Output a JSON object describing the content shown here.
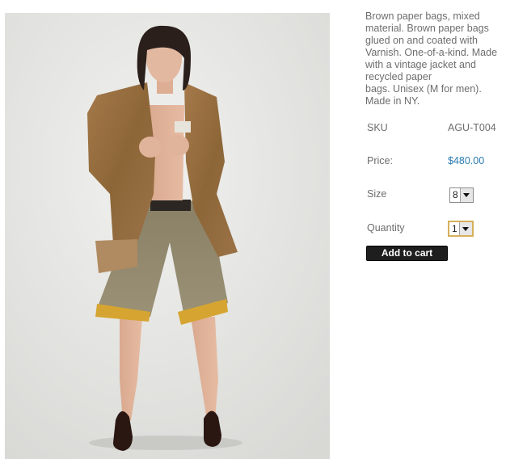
{
  "product": {
    "image_alt": "Model wearing brown paper bag jacket and khaki shorts",
    "description_lines": [
      "Brown paper bags, mixed",
      "material. Brown paper bags",
      "glued on and coated with",
      "Varnish. One-of-a-kind. Made",
      "with a vintage jacket and",
      "recycled paper",
      "bags. Unisex (M for men).",
      "Made in NY."
    ],
    "sku_label": "SKU",
    "sku_value": "AGU-T004",
    "price_label": "Price:",
    "price_value": "$480.00",
    "size_label": "Size",
    "size_selected": "8",
    "quantity_label": "Quantity",
    "quantity_selected": "1",
    "add_to_cart_label": "Add to cart"
  },
  "colors": {
    "text": "#6d6d6d",
    "price": "#2b7bb0",
    "button_bg": "#1e1e1e",
    "quantity_focus": "#d6b15a"
  }
}
